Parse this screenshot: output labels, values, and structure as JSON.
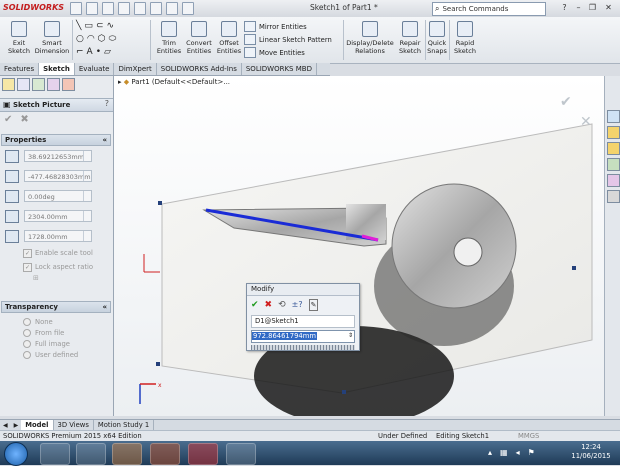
{
  "window": {
    "app_logo": "SOLIDWORKS",
    "doc_title": "Sketch1 of Part1 *",
    "search_placeholder": "Search Commands",
    "help_mark": "?"
  },
  "command_manager": {
    "exit_sketch": "Exit Sketch",
    "smart_dimension": "Smart Dimension",
    "trim_entities": "Trim Entities",
    "convert_entities": "Convert Entities",
    "offset_entities": "Offset Entities",
    "mirror_entities": "Mirror Entities",
    "linear_sketch_pattern": "Linear Sketch Pattern",
    "move_entities": "Move Entities",
    "display_delete_relations": "Display/Delete Relations",
    "repair_sketch": "Repair Sketch",
    "quick_snaps": "Quick Snaps",
    "rapid_sketch": "Rapid Sketch"
  },
  "tabs": [
    "Features",
    "Sketch",
    "Evaluate",
    "DimXpert",
    "SOLIDWORKS Add-Ins",
    "SOLIDWORKS MBD"
  ],
  "active_tab": "Sketch",
  "panel": {
    "title": "Sketch Picture",
    "properties_header": "Properties",
    "fields": {
      "x_pos": "38.69212653mm",
      "y_pos": "-477.46828303mm",
      "angle": "0.00deg",
      "width": "2304.00mm",
      "height": "1728.00mm"
    },
    "enable_scale_tool": "Enable scale tool",
    "lock_aspect_ratio": "Lock aspect ratio",
    "transparency_header": "Transparency",
    "transparency_options": [
      "None",
      "From file",
      "Full image",
      "User defined"
    ]
  },
  "tree": {
    "part_label": "Part1  (Default<<Default>..."
  },
  "modify": {
    "title": "Modify",
    "name": "D1@Sketch1",
    "value": "972.86461794mm"
  },
  "bottom_tabs": [
    "Model",
    "3D Views",
    "Motion Study 1"
  ],
  "active_bottom_tab": "Model",
  "status": {
    "edition": "SOLIDWORKS Premium 2015 x64 Edition",
    "state": "Under Defined",
    "editing": "Editing Sketch1",
    "units": "MMGS"
  },
  "clock": {
    "time": "12:24",
    "date": "11/06/2015"
  },
  "colors": {
    "accent": "#316ac5",
    "sketch_line": "#1a2bd6",
    "logo_red": "#c41e1e"
  }
}
